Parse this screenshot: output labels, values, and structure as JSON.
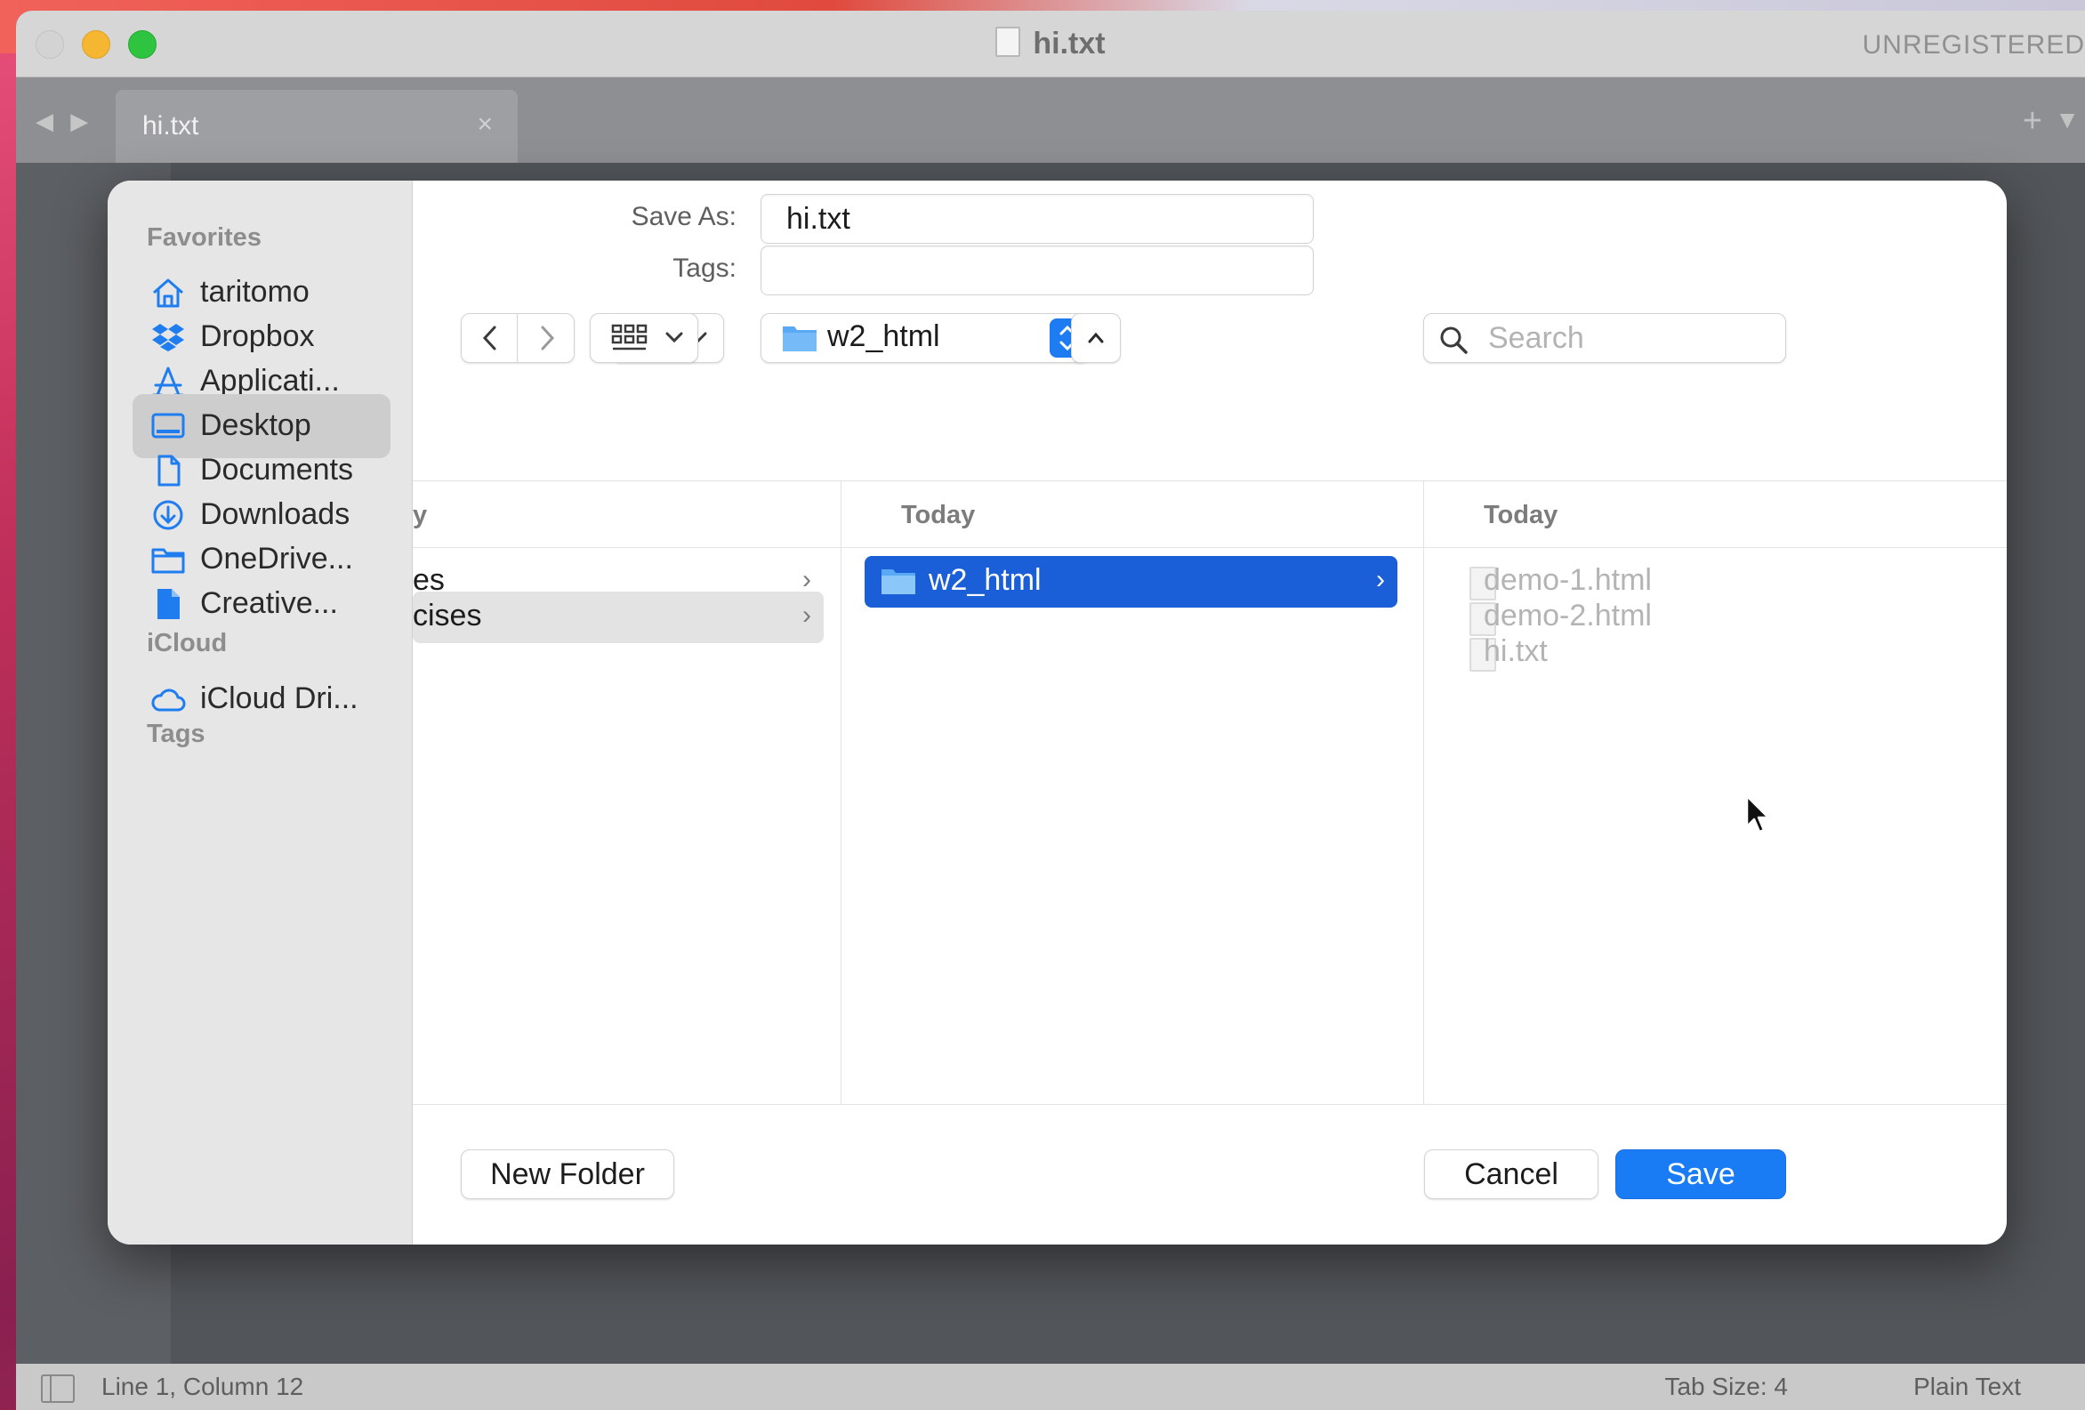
{
  "window": {
    "title": "hi.txt",
    "registration": "UNREGISTERED",
    "tab_label": "hi.txt",
    "tab_close": "×",
    "tab_nav": "◀ ▶",
    "new_tab": "+",
    "tab_menu": "▼"
  },
  "status_bar": {
    "position": "Line 1, Column 12",
    "tab_size": "Tab Size: 4",
    "syntax": "Plain Text"
  },
  "dialog": {
    "save_as_label": "Save As:",
    "save_as_value": "hi.txt",
    "tags_label": "Tags:",
    "tags_value": "",
    "location": "w2_html",
    "search_placeholder": "Search",
    "new_folder": "New Folder",
    "cancel": "Cancel",
    "save": "Save"
  },
  "sidebar": {
    "favorites_heading": "Favorites",
    "icloud_heading": "iCloud",
    "tags_heading": "Tags",
    "items": [
      {
        "label": "taritomo",
        "icon": "home-icon"
      },
      {
        "label": "Dropbox",
        "icon": "dropbox-icon"
      },
      {
        "label": "Applicati...",
        "icon": "applications-icon"
      },
      {
        "label": "Desktop",
        "icon": "desktop-icon",
        "selected": true
      },
      {
        "label": "Documents",
        "icon": "document-icon"
      },
      {
        "label": "Downloads",
        "icon": "downloads-icon"
      },
      {
        "label": "OneDrive...",
        "icon": "folder-icon"
      },
      {
        "label": "Creative...",
        "icon": "file-icon"
      },
      {
        "label": "iCloud Dri...",
        "icon": "cloud-icon"
      }
    ]
  },
  "columns": [
    {
      "heading": "y",
      "rows": [
        {
          "label": "es",
          "chevron": "›"
        },
        {
          "label": "cises",
          "chevron": "›",
          "highlighted": true
        }
      ]
    },
    {
      "heading": "Today",
      "rows": [
        {
          "label": "w2_html",
          "chevron": "›",
          "selected": true
        }
      ]
    },
    {
      "heading": "Today",
      "rows": [
        {
          "label": "demo-1.html"
        },
        {
          "label": "demo-2.html"
        },
        {
          "label": "hi.txt"
        }
      ]
    }
  ],
  "colors": {
    "accent": "#1a7cf5",
    "selection": "#1a5fd8",
    "sidebar_icon": "#1f7df0"
  }
}
